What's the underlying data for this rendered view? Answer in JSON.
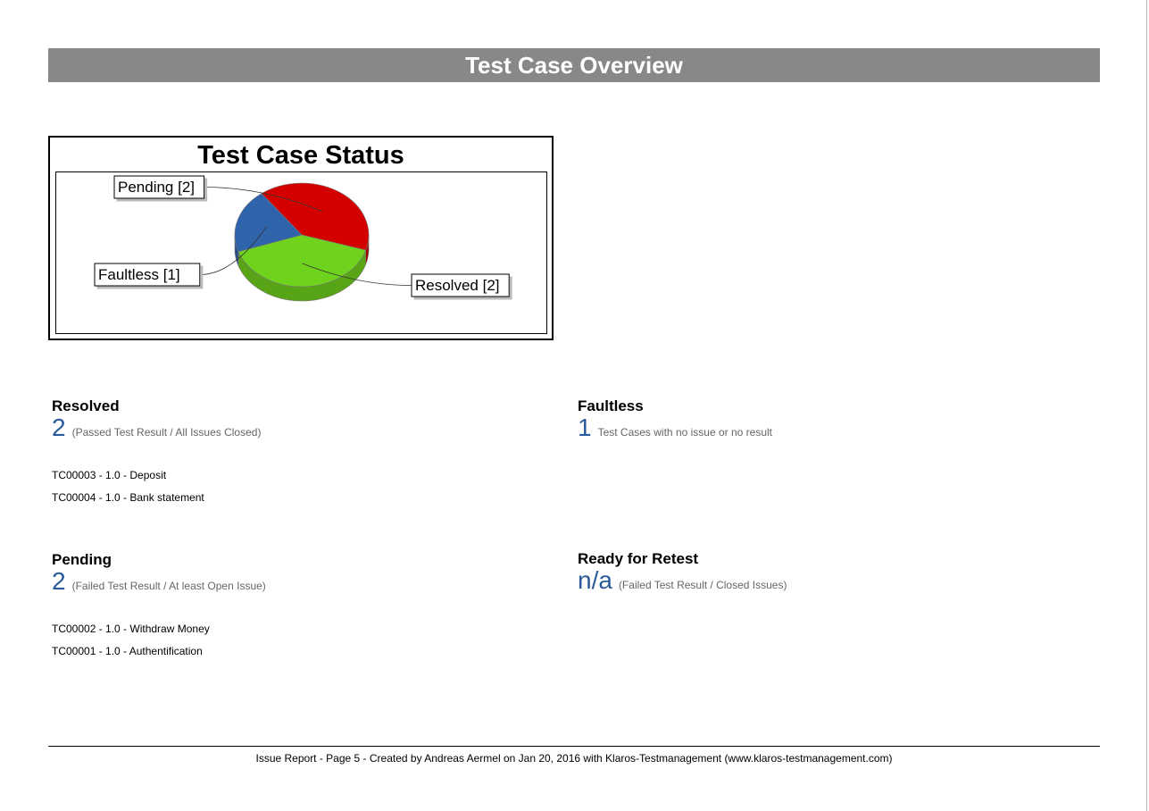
{
  "header": {
    "title": "Test Case Overview"
  },
  "chart_data": {
    "type": "pie",
    "title": "Test Case Status",
    "categories": [
      "Pending",
      "Resolved",
      "Faultless"
    ],
    "values": [
      2,
      2,
      1
    ],
    "labels": [
      "Pending [2]",
      "Resolved [2]",
      "Faultless [1]"
    ],
    "colors": [
      "#d40000",
      "#6fd21c",
      "#2f64aa"
    ],
    "three_d": true
  },
  "sections": {
    "resolved": {
      "heading": "Resolved",
      "count": "2",
      "description": "(Passed Test Result / All Issues Closed)",
      "items": [
        "TC00003 - 1.0 - Deposit",
        "TC00004 - 1.0 - Bank statement"
      ]
    },
    "faultless": {
      "heading": "Faultless",
      "count": "1",
      "description": "Test Cases with no issue or no result"
    },
    "pending": {
      "heading": "Pending",
      "count": "2",
      "description": "(Failed Test Result / At least Open Issue)",
      "items": [
        "TC00002 - 1.0 - Withdraw Money",
        "TC00001 - 1.0 - Authentification"
      ]
    },
    "ready_for_retest": {
      "heading": "Ready for Retest",
      "count": "n/a",
      "description": "(Failed Test Result / Closed Issues)"
    }
  },
  "footer": {
    "text": "Issue Report - Page 5 - Created by Andreas Aermel on Jan 20, 2016 with Klaros-Testmanagement (www.klaros-testmanagement.com)"
  }
}
